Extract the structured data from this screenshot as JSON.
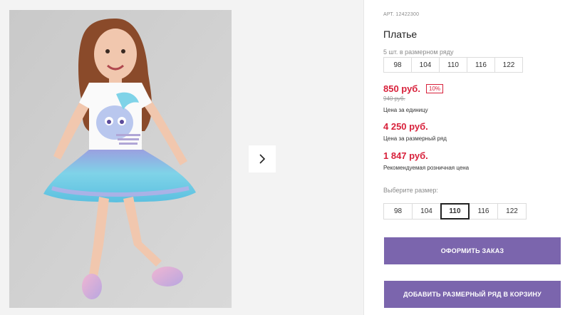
{
  "product": {
    "article": "АРТ. 12422300",
    "name": "Платье",
    "pack_label": "5 шт. в размерном ряду",
    "pack_sizes": [
      "98",
      "104",
      "110",
      "116",
      "122"
    ]
  },
  "pricing": {
    "unit_price": "850 руб.",
    "discount": "10%",
    "old_price": "940 руб.",
    "unit_caption": "Цена за единицу",
    "pack_price": "4 250 руб.",
    "pack_caption": "Цена за размерный ряд",
    "retail_price": "1 847 руб.",
    "retail_caption": "Рекомендуемая розничная цена"
  },
  "size_select": {
    "label": "Выберите размер:",
    "options": [
      "98",
      "104",
      "110",
      "116",
      "122"
    ],
    "selected": "110"
  },
  "actions": {
    "order_label": "ОФОРМИТЬ ЗАКАЗ",
    "add_pack_label": "ДОБАВИТЬ РАЗМЕРНЫЙ РЯД В КОРЗИНУ"
  },
  "colors": {
    "price_red": "#d8213b",
    "button_purple": "#7b65ad"
  },
  "icons": {
    "next": "chevron-right-icon"
  }
}
